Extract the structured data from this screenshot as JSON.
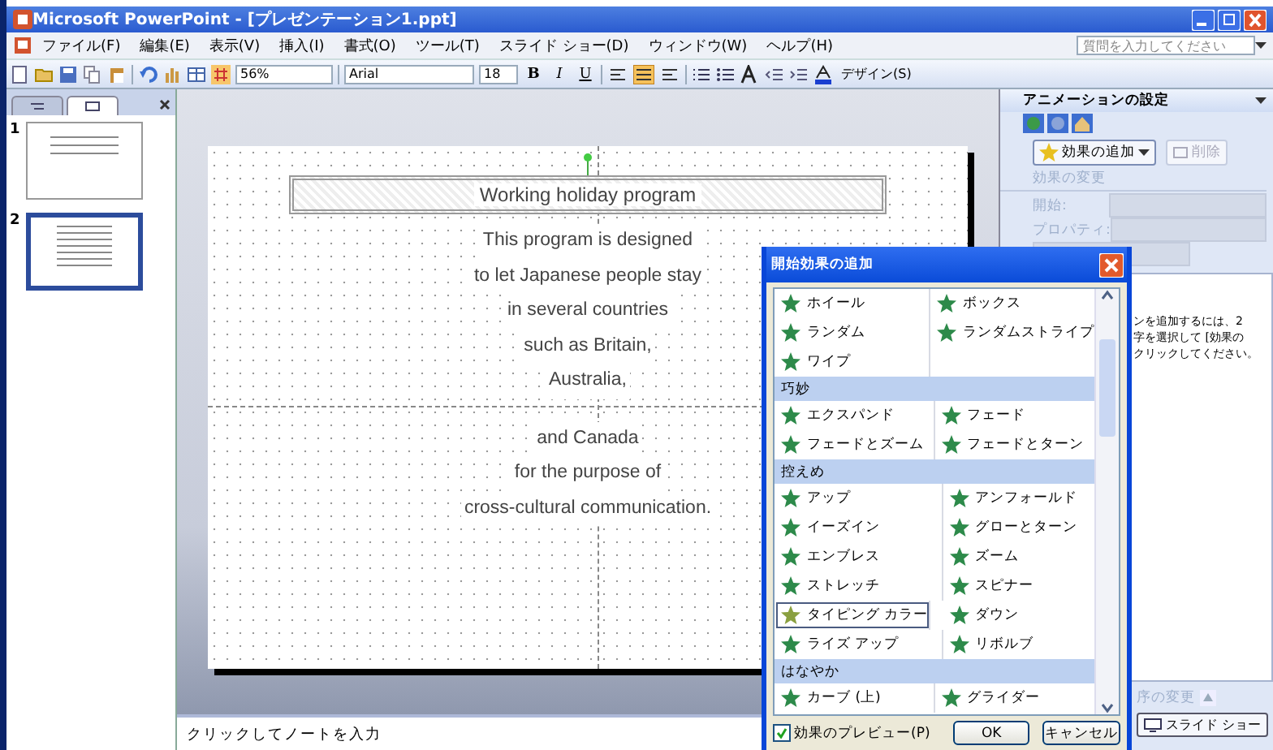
{
  "window": {
    "title": "Microsoft PowerPoint - [プレゼンテーション1.ppt]"
  },
  "menu": [
    "ファイル(F)",
    "編集(E)",
    "表示(V)",
    "挿入(I)",
    "書式(O)",
    "ツール(T)",
    "スライド ショー(D)",
    "ウィンドウ(W)",
    "ヘルプ(H)"
  ],
  "help_box": {
    "placeholder": "質問を入力してください"
  },
  "toolbar": {
    "zoom": "56%",
    "font": "Arial",
    "font_size": "18",
    "design_button": "デザイン(S)",
    "format_buttons": [
      {
        "label": "B",
        "kind": "bold"
      },
      {
        "label": "I",
        "kind": "italic"
      },
      {
        "label": "U",
        "kind": "underline"
      }
    ],
    "align_buttons": [
      {
        "selected": false
      },
      {
        "selected": true
      },
      {
        "selected": false
      }
    ]
  },
  "slide_panel": {
    "tabs": [
      {
        "selected": false
      },
      {
        "selected": true
      }
    ],
    "thumbnails": [
      {
        "number": "1",
        "selected": false
      },
      {
        "number": "2",
        "selected": true
      }
    ]
  },
  "slide": {
    "title": "Working holiday program",
    "body": [
      "This program is designed",
      "to let Japanese people stay",
      "in several countries",
      "such as Britain,",
      "Australia,",
      "and Canada",
      "for the purpose of",
      "cross-cultural communication."
    ]
  },
  "notes": {
    "placeholder": "クリックしてノートを入力"
  },
  "task_pane": {
    "title": "アニメーションの設定",
    "add_effect": "効果の追加",
    "remove": "削除",
    "change_label": "効果の変更",
    "fields": [
      {
        "label": "開始:"
      },
      {
        "label": "プロパティ:"
      }
    ],
    "hint_lines": [
      "ンを追加するには、2",
      "字を選択して [効果の",
      "クリックしてください。"
    ],
    "reorder": "序の変更",
    "slideshow_button": "スライド ショー"
  },
  "dialog": {
    "title": "開始効果の追加",
    "sections": [
      {
        "items": [
          {
            "label": "ホイール",
            "selected": false
          },
          {
            "label": "ボックス",
            "selected": false
          },
          {
            "label": "ランダム",
            "selected": false
          },
          {
            "label": "ランダムストライプ",
            "selected": false
          },
          {
            "label": "ワイプ",
            "selected": false
          }
        ]
      },
      {
        "header": "巧妙",
        "items": [
          {
            "label": "エクスパンド",
            "selected": false
          },
          {
            "label": "フェード",
            "selected": false
          },
          {
            "label": "フェードとズーム",
            "selected": false
          },
          {
            "label": "フェードとターン",
            "selected": false
          }
        ]
      },
      {
        "header": "控えめ",
        "items": [
          {
            "label": "アップ",
            "selected": false
          },
          {
            "label": "アンフォールド",
            "selected": false
          },
          {
            "label": "イーズイン",
            "selected": false
          },
          {
            "label": "グローとターン",
            "selected": false
          },
          {
            "label": "エンブレス",
            "selected": false
          },
          {
            "label": "ズーム",
            "selected": false
          },
          {
            "label": "ストレッチ",
            "selected": false
          },
          {
            "label": "スピナー",
            "selected": false
          },
          {
            "label": "タイピング カラー",
            "selected": true
          },
          {
            "label": "ダウン",
            "selected": false
          },
          {
            "label": "ライズ アップ",
            "selected": false
          },
          {
            "label": "リボルブ",
            "selected": false
          }
        ]
      },
      {
        "header": "はなやか",
        "items": [
          {
            "label": "カーブ (上)",
            "selected": false
          },
          {
            "label": "グライダー",
            "selected": false
          }
        ]
      }
    ],
    "preview": {
      "label": "効果のプレビュー(P)",
      "checked": true
    },
    "buttons": [
      "OK",
      "キャンセル"
    ]
  }
}
